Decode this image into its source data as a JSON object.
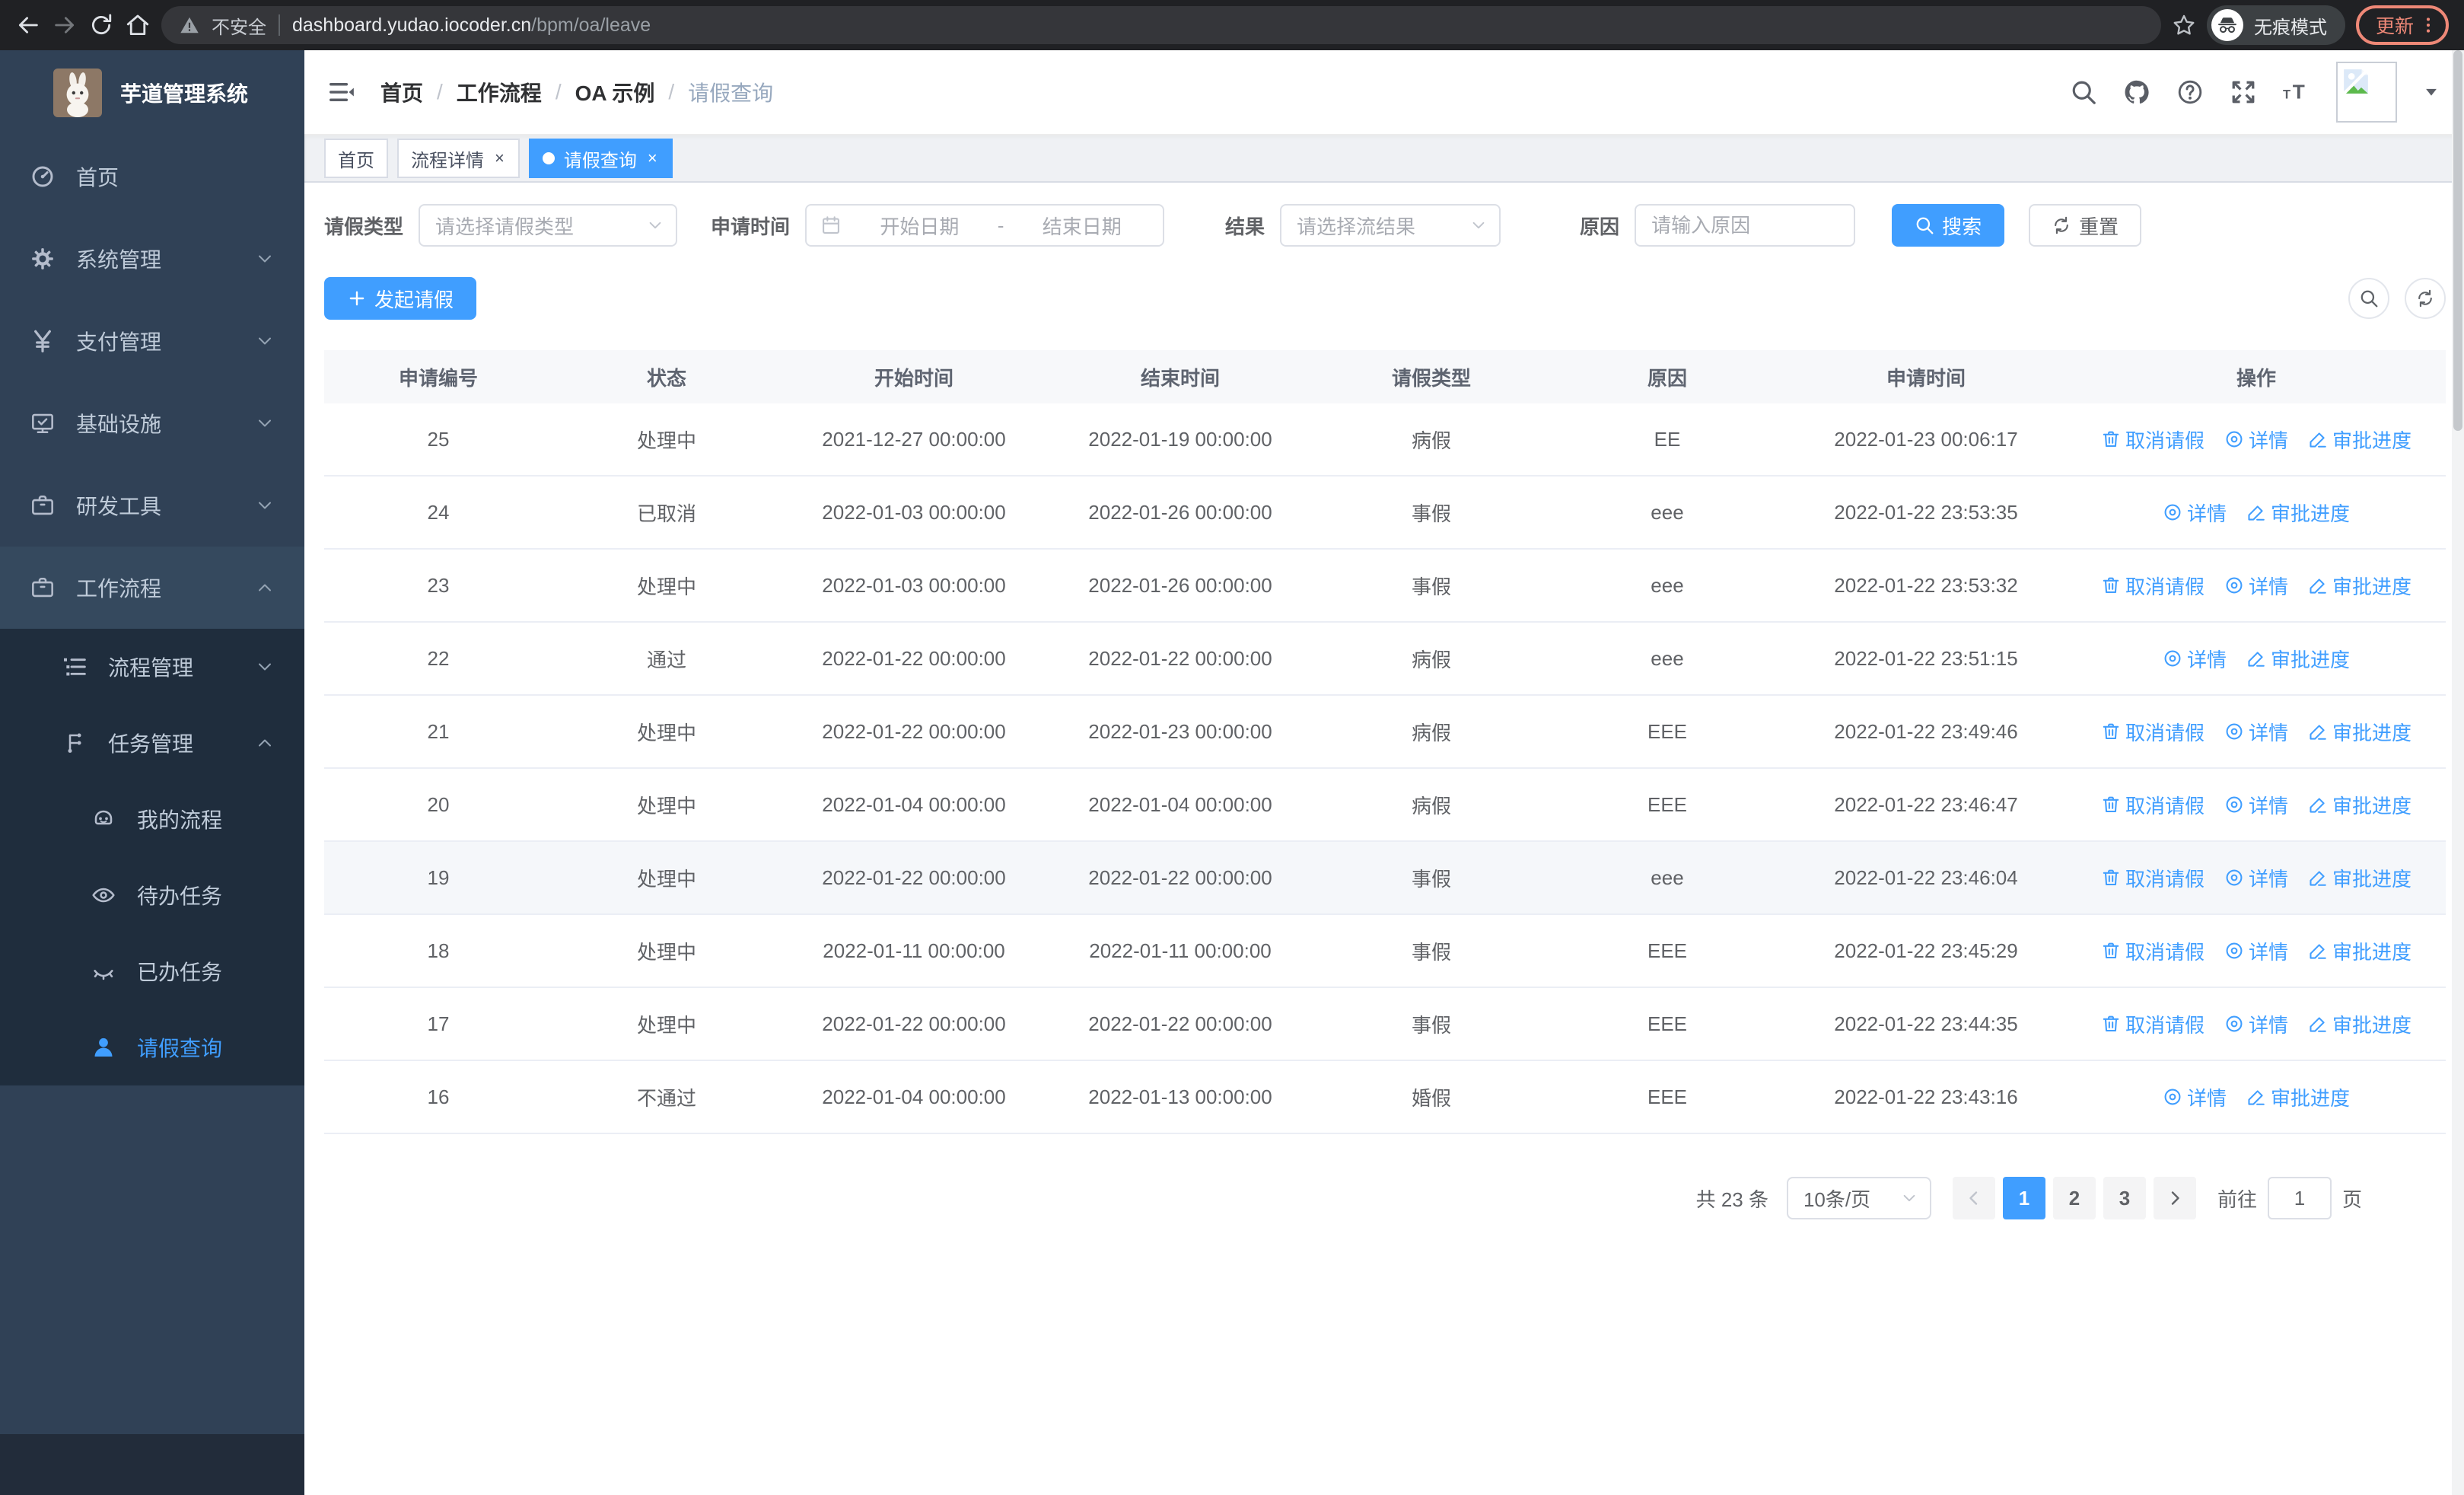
{
  "colors": {
    "accent": "#409eff",
    "sidebar": "#304156",
    "sidebar_submenu": "#1f2d3d",
    "update_badge": "#ee8877"
  },
  "browser": {
    "security_label": "不安全",
    "url_host": "dashboard.yudao.iocoder.cn",
    "url_path": "/bpm/oa/leave",
    "incognito_label": "无痕模式",
    "update_label": "更新"
  },
  "sidebar": {
    "title": "芋道管理系统",
    "items": [
      {
        "icon": "gauge",
        "label": "首页",
        "level": 0
      },
      {
        "icon": "gear",
        "label": "系统管理",
        "level": 0,
        "chevron": "down"
      },
      {
        "icon": "yen",
        "label": "支付管理",
        "level": 0,
        "chevron": "down"
      },
      {
        "icon": "monitor",
        "label": "基础设施",
        "level": 0,
        "chevron": "down"
      },
      {
        "icon": "case",
        "label": "研发工具",
        "level": 0,
        "chevron": "down"
      },
      {
        "icon": "case",
        "label": "工作流程",
        "level": 0,
        "chevron": "up",
        "open": true
      },
      {
        "icon": "list",
        "label": "流程管理",
        "level": 1,
        "chevron": "down"
      },
      {
        "icon": "flow",
        "label": "任务管理",
        "level": 1,
        "chevron": "up"
      },
      {
        "icon": "robot",
        "label": "我的流程",
        "level": 2
      },
      {
        "icon": "eye",
        "label": "待办任务",
        "level": 2
      },
      {
        "icon": "eyeclosed",
        "label": "已办任务",
        "level": 2
      },
      {
        "icon": "user",
        "label": "请假查询",
        "level": 2,
        "active": true
      }
    ]
  },
  "breadcrumb": {
    "items": [
      "首页",
      "工作流程",
      "OA 示例",
      "请假查询"
    ]
  },
  "tabs": [
    {
      "label": "首页",
      "closable": false,
      "active": false
    },
    {
      "label": "流程详情",
      "closable": true,
      "active": false
    },
    {
      "label": "请假查询",
      "closable": true,
      "active": true
    }
  ],
  "filters": {
    "leave_type_label": "请假类型",
    "leave_type_placeholder": "请选择请假类型",
    "apply_time_label": "申请时间",
    "start_placeholder": "开始日期",
    "range_separator": "-",
    "end_placeholder": "结束日期",
    "result_label": "结果",
    "result_placeholder": "请选择流结果",
    "reason_label": "原因",
    "reason_placeholder": "请输入原因",
    "search_label": "搜索",
    "reset_label": "重置"
  },
  "toolbar": {
    "create_label": "发起请假"
  },
  "row_actions": {
    "cancel": "取消请假",
    "detail": "详情",
    "progress": "审批进度"
  },
  "table": {
    "columns": [
      "申请编号",
      "状态",
      "开始时间",
      "结束时间",
      "请假类型",
      "原因",
      "申请时间",
      "操作"
    ],
    "rows": [
      {
        "id": "25",
        "status": "处理中",
        "start": "2021-12-27 00:00:00",
        "end": "2022-01-19 00:00:00",
        "type": "病假",
        "reason": "EE",
        "applied": "2022-01-23 00:06:17",
        "cancel": true,
        "highlight": false
      },
      {
        "id": "24",
        "status": "已取消",
        "start": "2022-01-03 00:00:00",
        "end": "2022-01-26 00:00:00",
        "type": "事假",
        "reason": "eee",
        "applied": "2022-01-22 23:53:35",
        "cancel": false,
        "highlight": false
      },
      {
        "id": "23",
        "status": "处理中",
        "start": "2022-01-03 00:00:00",
        "end": "2022-01-26 00:00:00",
        "type": "事假",
        "reason": "eee",
        "applied": "2022-01-22 23:53:32",
        "cancel": true,
        "highlight": false
      },
      {
        "id": "22",
        "status": "通过",
        "start": "2022-01-22 00:00:00",
        "end": "2022-01-22 00:00:00",
        "type": "病假",
        "reason": "eee",
        "applied": "2022-01-22 23:51:15",
        "cancel": false,
        "highlight": false
      },
      {
        "id": "21",
        "status": "处理中",
        "start": "2022-01-22 00:00:00",
        "end": "2022-01-23 00:00:00",
        "type": "病假",
        "reason": "EEE",
        "applied": "2022-01-22 23:49:46",
        "cancel": true,
        "highlight": false
      },
      {
        "id": "20",
        "status": "处理中",
        "start": "2022-01-04 00:00:00",
        "end": "2022-01-04 00:00:00",
        "type": "病假",
        "reason": "EEE",
        "applied": "2022-01-22 23:46:47",
        "cancel": true,
        "highlight": false
      },
      {
        "id": "19",
        "status": "处理中",
        "start": "2022-01-22 00:00:00",
        "end": "2022-01-22 00:00:00",
        "type": "事假",
        "reason": "eee",
        "applied": "2022-01-22 23:46:04",
        "cancel": true,
        "highlight": true
      },
      {
        "id": "18",
        "status": "处理中",
        "start": "2022-01-11 00:00:00",
        "end": "2022-01-11 00:00:00",
        "type": "事假",
        "reason": "EEE",
        "applied": "2022-01-22 23:45:29",
        "cancel": true,
        "highlight": false
      },
      {
        "id": "17",
        "status": "处理中",
        "start": "2022-01-22 00:00:00",
        "end": "2022-01-22 00:00:00",
        "type": "事假",
        "reason": "EEE",
        "applied": "2022-01-22 23:44:35",
        "cancel": true,
        "highlight": false
      },
      {
        "id": "16",
        "status": "不通过",
        "start": "2022-01-04 00:00:00",
        "end": "2022-01-13 00:00:00",
        "type": "婚假",
        "reason": "EEE",
        "applied": "2022-01-22 23:43:16",
        "cancel": false,
        "highlight": false
      }
    ]
  },
  "pagination": {
    "total_label": "共 23 条",
    "page_size_label": "10条/页",
    "pages": [
      "1",
      "2",
      "3"
    ],
    "active_page": "1",
    "jumper_prefix": "前往",
    "jumper_value": "1",
    "jumper_suffix": "页"
  }
}
